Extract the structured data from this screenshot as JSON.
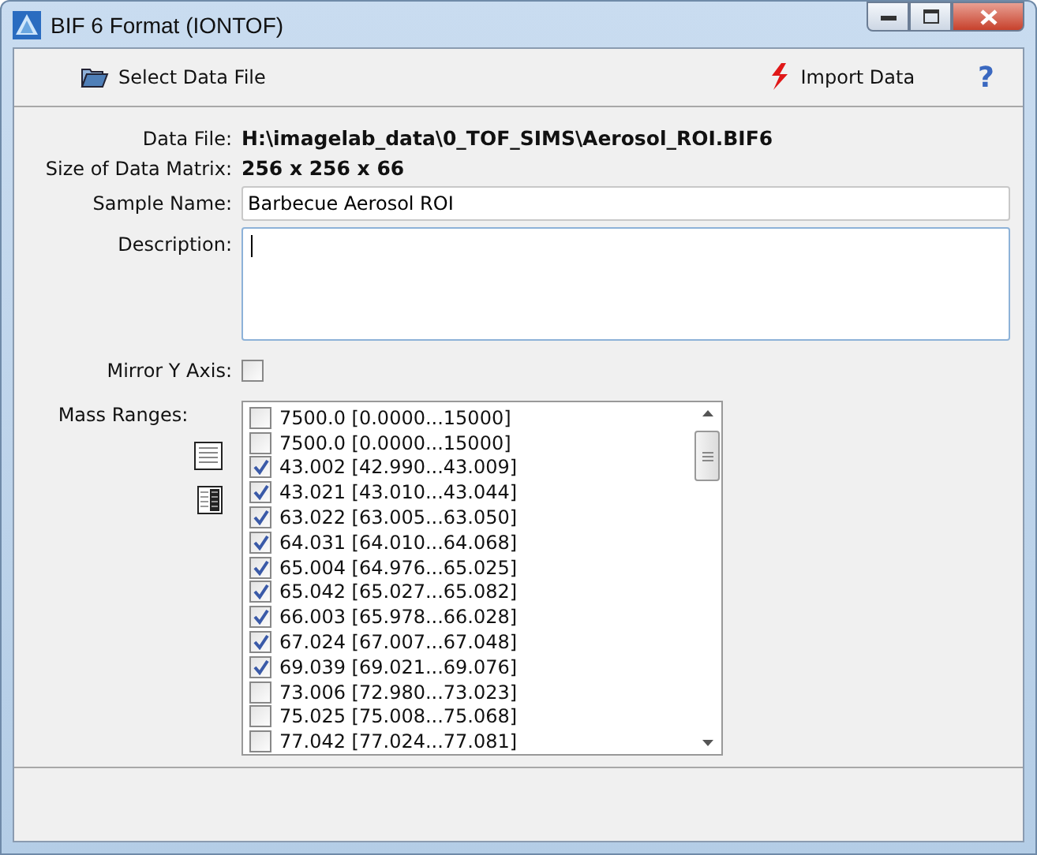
{
  "window": {
    "title": "BIF 6 Format (IONTOF)"
  },
  "toolbar": [
    {
      "kind": "folder",
      "label": "Select Data File"
    },
    {
      "kind": "import",
      "label": "Import Data"
    },
    {
      "kind": "help",
      "label": "?"
    }
  ],
  "info": [
    {
      "label": "Data File:",
      "value": "H:\\imagelab_data\\0_TOF_SIMS\\Aerosol_ROI.BIF6"
    },
    {
      "label": "Size of Data Matrix:",
      "value": "256 x 256 x 66"
    }
  ],
  "sample_name": {
    "label": "Sample Name:",
    "value": "Barbecue Aerosol ROI"
  },
  "description": {
    "label": "Description:"
  },
  "mirror_y": {
    "label": "Mirror Y Axis:",
    "checked": false
  },
  "mass_ranges": {
    "label": "Mass Ranges:",
    "items": [
      {
        "label": "7500.0 [0.0000...15000]",
        "checked": false
      },
      {
        "label": "7500.0 [0.0000...15000]",
        "checked": false
      },
      {
        "label": "43.002 [42.990...43.009]",
        "checked": true
      },
      {
        "label": "43.021 [43.010...43.044]",
        "checked": true
      },
      {
        "label": "63.022 [63.005...63.050]",
        "checked": true
      },
      {
        "label": "64.031 [64.010...64.068]",
        "checked": true
      },
      {
        "label": "65.004 [64.976...65.025]",
        "checked": true
      },
      {
        "label": "65.042 [65.027...65.082]",
        "checked": true
      },
      {
        "label": "66.003 [65.978...66.028]",
        "checked": true
      },
      {
        "label": "67.024 [67.007...67.048]",
        "checked": true
      },
      {
        "label": "69.039 [69.021...69.076]",
        "checked": true
      },
      {
        "label": "73.006 [72.980...73.023]",
        "checked": false
      },
      {
        "label": "75.025 [75.008...75.068]",
        "checked": false
      },
      {
        "label": "77.042 [77.024...77.081]",
        "checked": false
      }
    ]
  }
}
